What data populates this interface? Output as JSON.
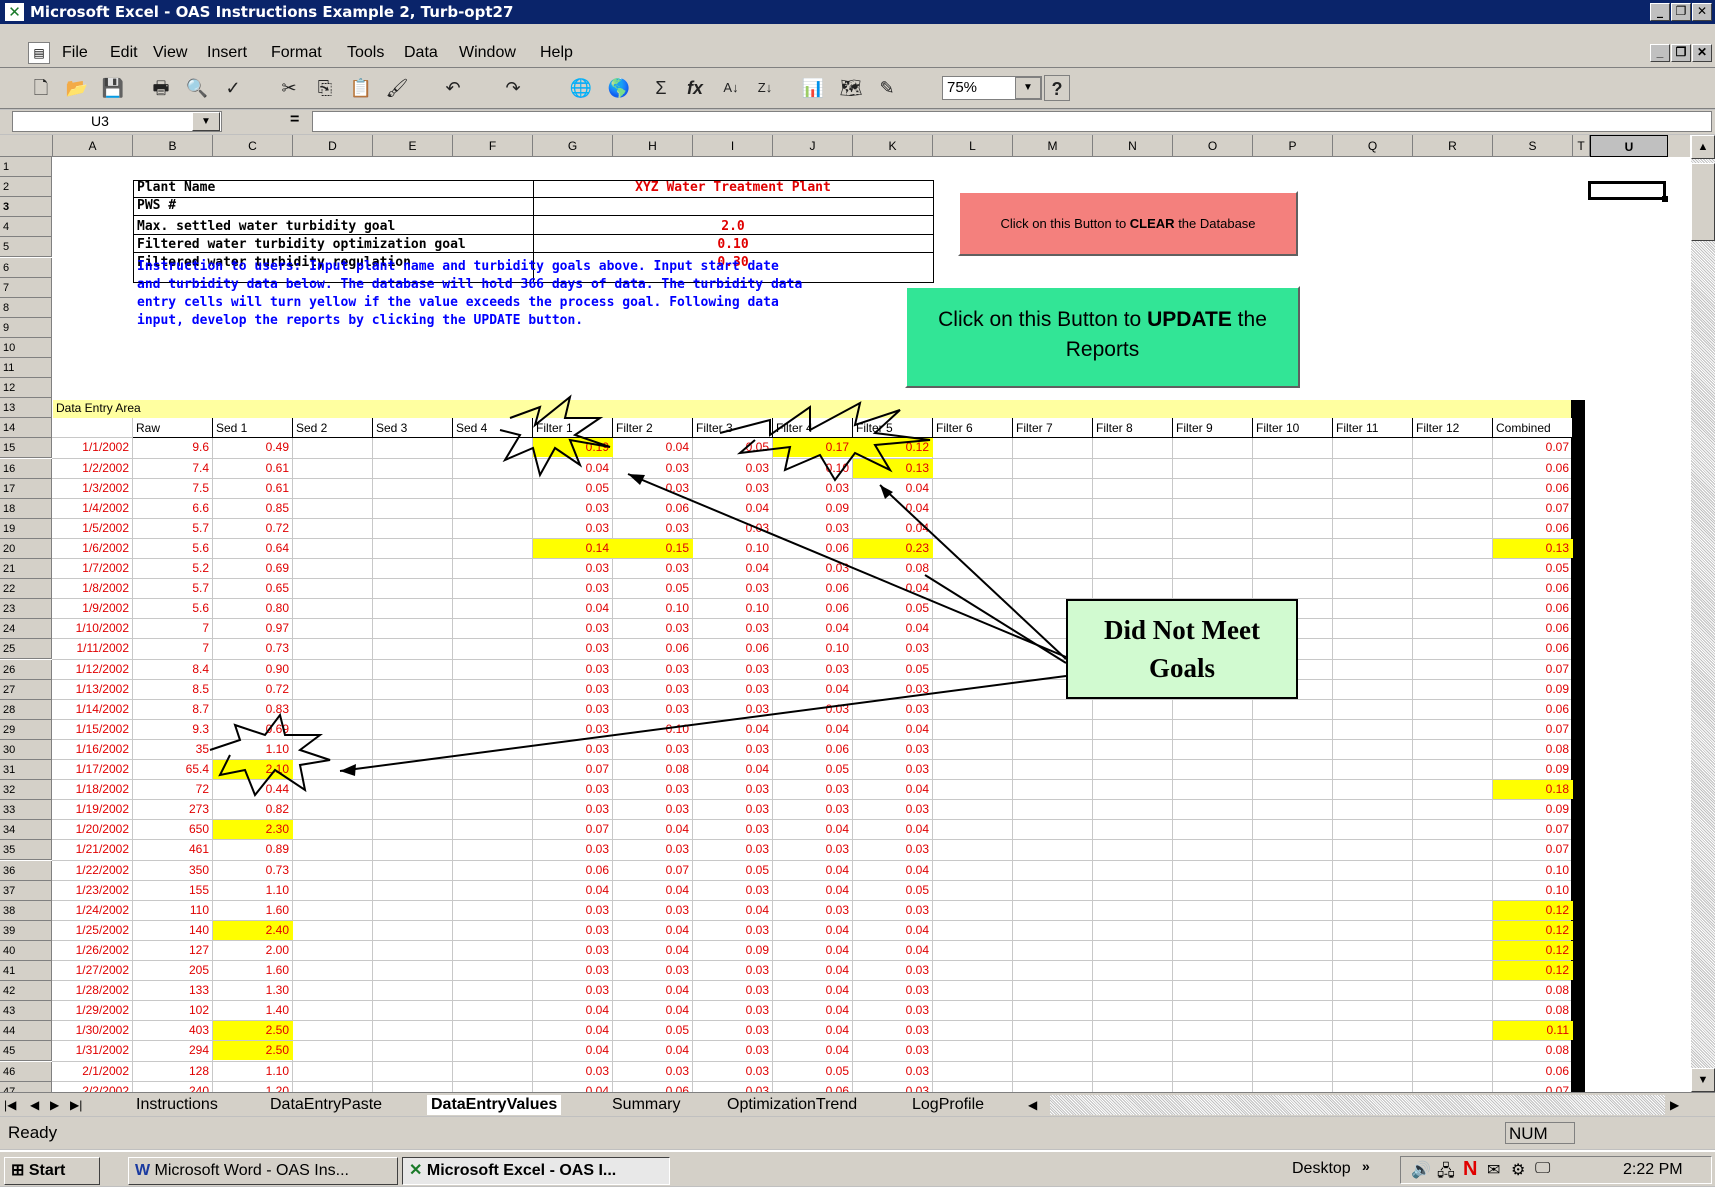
{
  "window": {
    "title": "Microsoft Excel - OAS Instructions Example 2, Turb-opt27"
  },
  "menu": [
    "File",
    "Edit",
    "View",
    "Insert",
    "Format",
    "Tools",
    "Data",
    "Window",
    "Help"
  ],
  "toolbar": {
    "zoom": "75%"
  },
  "formula_bar": {
    "name_box": "U3",
    "equals": "="
  },
  "columns": [
    "A",
    "B",
    "C",
    "D",
    "E",
    "F",
    "G",
    "H",
    "I",
    "J",
    "K",
    "L",
    "M",
    "N",
    "O",
    "P",
    "Q",
    "R",
    "S",
    "T",
    "U"
  ],
  "header_block": {
    "plant_name_label": "Plant Name",
    "plant_name_value": "XYZ  Water Treatment Plant",
    "pws_label": "PWS #",
    "max_settled_label": "Max. settled water turbidity goal",
    "max_settled_value": "2.0",
    "filtered_opt_label": "Filtered water turbidity optimization goal",
    "filtered_opt_value": "0.10",
    "filtered_reg_label": "Filtered water turbidity regulation",
    "filtered_reg_value": "0.30",
    "instructions": [
      "Instruction to users:  Input plant name and turbidity goals above.  Input start date",
      "and turbidity data below.  The database will hold 366 days of data.  The turbidity data",
      "entry cells will turn yellow if the value exceeds the process goal.  Following data",
      "input, develop the reports by clicking the UPDATE button."
    ]
  },
  "buttons": {
    "clear_prefix": "Click on this Button to ",
    "clear_bold": "CLEAR",
    "clear_suffix": " the Database",
    "update_prefix": "Click on this Button to ",
    "update_bold": "UPDATE",
    "update_suffix": " the",
    "update_line2": "Reports"
  },
  "callout": {
    "line1": "Did Not Meet",
    "line2": "Goals"
  },
  "data_entry_label": "Data Entry Area",
  "table_headers": [
    "Raw",
    "Sed 1",
    "Sed 2",
    "Sed 3",
    "Sed 4",
    "Filter 1",
    "Filter 2",
    "Filter 3",
    "Filter 4",
    "Filter 5",
    "Filter 6",
    "Filter 7",
    "Filter 8",
    "Filter 9",
    "Filter 10",
    "Filter 11",
    "Filter 12",
    "Combined"
  ],
  "rows": [
    {
      "r": 15,
      "date": "1/1/2002",
      "raw": "9.6",
      "sed1": "0.49",
      "f": [
        "0.19",
        "0.04",
        "0.05",
        "0.17",
        "0.12"
      ],
      "comb": "0.07",
      "hl": [
        5,
        8,
        9
      ]
    },
    {
      "r": 16,
      "date": "1/2/2002",
      "raw": "7.4",
      "sed1": "0.61",
      "f": [
        "0.04",
        "0.03",
        "0.03",
        "0.10",
        "0.13"
      ],
      "comb": "0.06",
      "hl": [
        9
      ]
    },
    {
      "r": 17,
      "date": "1/3/2002",
      "raw": "7.5",
      "sed1": "0.61",
      "f": [
        "0.05",
        "0.03",
        "0.03",
        "0.03",
        "0.04"
      ],
      "comb": "0.06",
      "hl": []
    },
    {
      "r": 18,
      "date": "1/4/2002",
      "raw": "6.6",
      "sed1": "0.85",
      "f": [
        "0.03",
        "0.06",
        "0.04",
        "0.09",
        "0.04"
      ],
      "comb": "0.07",
      "hl": []
    },
    {
      "r": 19,
      "date": "1/5/2002",
      "raw": "5.7",
      "sed1": "0.72",
      "f": [
        "0.03",
        "0.03",
        "0.03",
        "0.03",
        "0.04"
      ],
      "comb": "0.06",
      "hl": []
    },
    {
      "r": 20,
      "date": "1/6/2002",
      "raw": "5.6",
      "sed1": "0.64",
      "f": [
        "0.14",
        "0.15",
        "0.10",
        "0.06",
        "0.23"
      ],
      "comb": "0.13",
      "hl": [
        5,
        6,
        9,
        17
      ]
    },
    {
      "r": 21,
      "date": "1/7/2002",
      "raw": "5.2",
      "sed1": "0.69",
      "f": [
        "0.03",
        "0.03",
        "0.04",
        "0.03",
        "0.08"
      ],
      "comb": "0.05",
      "hl": []
    },
    {
      "r": 22,
      "date": "1/8/2002",
      "raw": "5.7",
      "sed1": "0.65",
      "f": [
        "0.03",
        "0.05",
        "0.03",
        "0.06",
        "0.04"
      ],
      "comb": "0.06",
      "hl": []
    },
    {
      "r": 23,
      "date": "1/9/2002",
      "raw": "5.6",
      "sed1": "0.80",
      "f": [
        "0.04",
        "0.10",
        "0.10",
        "0.06",
        "0.05"
      ],
      "comb": "0.06",
      "hl": []
    },
    {
      "r": 24,
      "date": "1/10/2002",
      "raw": "7",
      "sed1": "0.97",
      "f": [
        "0.03",
        "0.03",
        "0.03",
        "0.04",
        "0.04"
      ],
      "comb": "0.06",
      "hl": []
    },
    {
      "r": 25,
      "date": "1/11/2002",
      "raw": "7",
      "sed1": "0.73",
      "f": [
        "0.03",
        "0.06",
        "0.06",
        "0.10",
        "0.03"
      ],
      "comb": "0.06",
      "hl": []
    },
    {
      "r": 26,
      "date": "1/12/2002",
      "raw": "8.4",
      "sed1": "0.90",
      "f": [
        "0.03",
        "0.03",
        "0.03",
        "0.03",
        "0.05"
      ],
      "comb": "0.07",
      "hl": []
    },
    {
      "r": 27,
      "date": "1/13/2002",
      "raw": "8.5",
      "sed1": "0.72",
      "f": [
        "0.03",
        "0.03",
        "0.03",
        "0.04",
        "0.03"
      ],
      "comb": "0.09",
      "hl": []
    },
    {
      "r": 28,
      "date": "1/14/2002",
      "raw": "8.7",
      "sed1": "0.83",
      "f": [
        "0.03",
        "0.03",
        "0.03",
        "0.03",
        "0.03"
      ],
      "comb": "0.06",
      "hl": []
    },
    {
      "r": 29,
      "date": "1/15/2002",
      "raw": "9.3",
      "sed1": "0.69",
      "f": [
        "0.03",
        "0.10",
        "0.04",
        "0.04",
        "0.04"
      ],
      "comb": "0.07",
      "hl": []
    },
    {
      "r": 30,
      "date": "1/16/2002",
      "raw": "35",
      "sed1": "1.10",
      "f": [
        "0.03",
        "0.03",
        "0.03",
        "0.06",
        "0.03"
      ],
      "comb": "0.08",
      "hl": []
    },
    {
      "r": 31,
      "date": "1/17/2002",
      "raw": "65.4",
      "sed1": "2.10",
      "f": [
        "0.07",
        "0.08",
        "0.04",
        "0.05",
        "0.03"
      ],
      "comb": "0.09",
      "hl": [
        1
      ]
    },
    {
      "r": 32,
      "date": "1/18/2002",
      "raw": "72",
      "sed1": "0.44",
      "f": [
        "0.03",
        "0.03",
        "0.03",
        "0.03",
        "0.04"
      ],
      "comb": "0.18",
      "hl": [
        17
      ]
    },
    {
      "r": 33,
      "date": "1/19/2002",
      "raw": "273",
      "sed1": "0.82",
      "f": [
        "0.03",
        "0.03",
        "0.03",
        "0.03",
        "0.03"
      ],
      "comb": "0.09",
      "hl": []
    },
    {
      "r": 34,
      "date": "1/20/2002",
      "raw": "650",
      "sed1": "2.30",
      "f": [
        "0.07",
        "0.04",
        "0.03",
        "0.04",
        "0.04"
      ],
      "comb": "0.07",
      "hl": [
        1
      ]
    },
    {
      "r": 35,
      "date": "1/21/2002",
      "raw": "461",
      "sed1": "0.89",
      "f": [
        "0.03",
        "0.03",
        "0.03",
        "0.03",
        "0.03"
      ],
      "comb": "0.07",
      "hl": []
    },
    {
      "r": 36,
      "date": "1/22/2002",
      "raw": "350",
      "sed1": "0.73",
      "f": [
        "0.06",
        "0.07",
        "0.05",
        "0.04",
        "0.04"
      ],
      "comb": "0.10",
      "hl": []
    },
    {
      "r": 37,
      "date": "1/23/2002",
      "raw": "155",
      "sed1": "1.10",
      "f": [
        "0.04",
        "0.04",
        "0.03",
        "0.04",
        "0.05"
      ],
      "comb": "0.10",
      "hl": []
    },
    {
      "r": 38,
      "date": "1/24/2002",
      "raw": "110",
      "sed1": "1.60",
      "f": [
        "0.03",
        "0.03",
        "0.04",
        "0.03",
        "0.03"
      ],
      "comb": "0.12",
      "hl": [
        17
      ]
    },
    {
      "r": 39,
      "date": "1/25/2002",
      "raw": "140",
      "sed1": "2.40",
      "f": [
        "0.03",
        "0.04",
        "0.03",
        "0.04",
        "0.04"
      ],
      "comb": "0.12",
      "hl": [
        1,
        17
      ]
    },
    {
      "r": 40,
      "date": "1/26/2002",
      "raw": "127",
      "sed1": "2.00",
      "f": [
        "0.03",
        "0.04",
        "0.09",
        "0.04",
        "0.04"
      ],
      "comb": "0.12",
      "hl": [
        17
      ]
    },
    {
      "r": 41,
      "date": "1/27/2002",
      "raw": "205",
      "sed1": "1.60",
      "f": [
        "0.03",
        "0.03",
        "0.03",
        "0.04",
        "0.03"
      ],
      "comb": "0.12",
      "hl": [
        17
      ]
    },
    {
      "r": 42,
      "date": "1/28/2002",
      "raw": "133",
      "sed1": "1.30",
      "f": [
        "0.03",
        "0.04",
        "0.03",
        "0.04",
        "0.03"
      ],
      "comb": "0.08",
      "hl": []
    },
    {
      "r": 43,
      "date": "1/29/2002",
      "raw": "102",
      "sed1": "1.40",
      "f": [
        "0.04",
        "0.04",
        "0.03",
        "0.04",
        "0.03"
      ],
      "comb": "0.08",
      "hl": []
    },
    {
      "r": 44,
      "date": "1/30/2002",
      "raw": "403",
      "sed1": "2.50",
      "f": [
        "0.04",
        "0.05",
        "0.03",
        "0.04",
        "0.03"
      ],
      "comb": "0.11",
      "hl": [
        1,
        17
      ]
    },
    {
      "r": 45,
      "date": "1/31/2002",
      "raw": "294",
      "sed1": "2.50",
      "f": [
        "0.04",
        "0.04",
        "0.03",
        "0.04",
        "0.03"
      ],
      "comb": "0.08",
      "hl": [
        1
      ]
    },
    {
      "r": 46,
      "date": "2/1/2002",
      "raw": "128",
      "sed1": "1.10",
      "f": [
        "0.03",
        "0.03",
        "0.03",
        "0.05",
        "0.03"
      ],
      "comb": "0.06",
      "hl": []
    },
    {
      "r": 47,
      "date": "2/2/2002",
      "raw": "240",
      "sed1": "1.20",
      "f": [
        "0.04",
        "0.06",
        "0.03",
        "0.06",
        "0.03"
      ],
      "comb": "0.07",
      "hl": []
    }
  ],
  "sheet_tabs": [
    "Instructions",
    "DataEntryPaste",
    "DataEntryValues",
    "Summary",
    "OptimizationTrend",
    "LogProfile"
  ],
  "active_tab": "DataEntryValues",
  "status": {
    "left": "Ready",
    "num": "NUM"
  },
  "taskbar": {
    "start": "Start",
    "word": "Microsoft Word - OAS Ins...",
    "excel": "Microsoft Excel - OAS I...",
    "desktop": "Desktop",
    "time": "2:22 PM"
  }
}
